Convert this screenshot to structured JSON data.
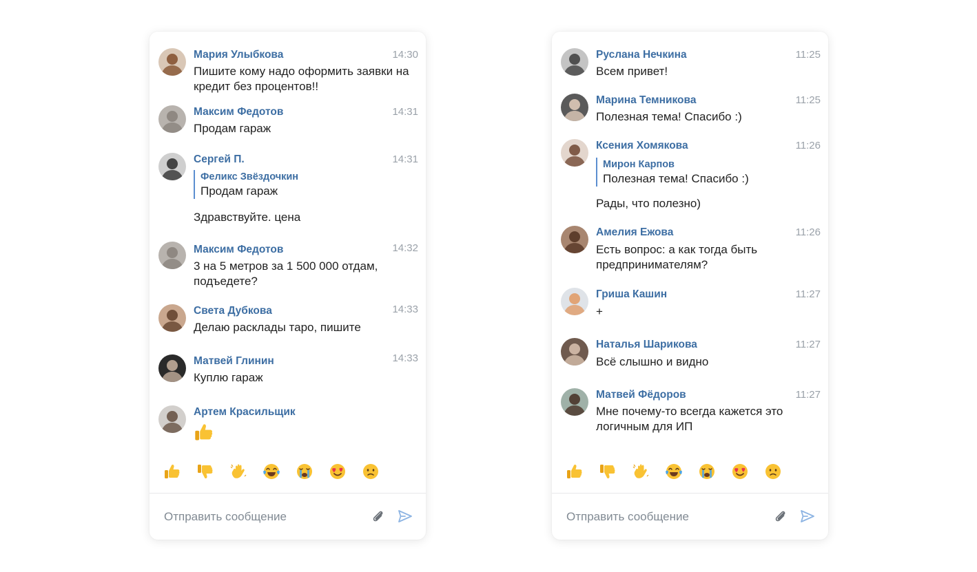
{
  "left_chat": {
    "messages": [
      {
        "author": "Мария Улыбкова",
        "time": "14:30",
        "text": "Пишите кому надо оформить заявки на кредит без процентов!!"
      },
      {
        "author": "Максим Федотов",
        "time": "14:31",
        "text": "Продам гараж"
      },
      {
        "author": "Сергей П.",
        "time": "14:31",
        "quote_author": "Феликс Звёздочкин",
        "quote_text": "Продам гараж",
        "text": "Здравствуйте. цена"
      },
      {
        "author": "Максим Федотов",
        "time": "14:32",
        "text": "3 на 5 метров за 1 500 000 отдам, подъедете?"
      },
      {
        "author": "Света Дубкова",
        "time": "14:33",
        "text": "Делаю расклады таро, пишите"
      },
      {
        "author": "Матвей Глинин",
        "time": "14:33",
        "text": "Куплю гараж"
      },
      {
        "author": "Артем Красильщик",
        "emoji": "thumbs-up-emoji"
      }
    ],
    "reactions": [
      "thumbs-up",
      "thumbs-down",
      "waving-hand",
      "tears-of-joy",
      "crying",
      "heart-eyes",
      "slightly-frowning"
    ],
    "composer": {
      "placeholder": "Отправить сообщение"
    }
  },
  "right_chat": {
    "messages": [
      {
        "author": "Руслана Нечкина",
        "time": "11:25",
        "text": "Всем привет!"
      },
      {
        "author": "Марина Темникова",
        "time": "11:25",
        "text": "Полезная тема! Спасибо :)"
      },
      {
        "author": "Ксения Хомякова",
        "time": "11:26",
        "quote_author": "Мирон Карпов",
        "quote_text": "Полезная тема! Спасибо :)",
        "text": "Рады, что полезно)"
      },
      {
        "author": "Амелия Ежова",
        "time": "11:26",
        "text": "Есть вопрос: а как тогда быть предпринимателям?"
      },
      {
        "author": "Гриша Кашин",
        "time": "11:27",
        "text": "+"
      },
      {
        "author": "Наталья Шарикова",
        "time": "11:27",
        "text": "Всё слышно и видно"
      },
      {
        "author": "Матвей Фёдоров",
        "time": "11:27",
        "text": "Мне почему-то всегда кажется это логичным для ИП"
      }
    ],
    "reactions": [
      "thumbs-up",
      "thumbs-down",
      "waving-hand",
      "tears-of-joy",
      "crying",
      "heart-eyes",
      "slightly-frowning"
    ],
    "composer": {
      "placeholder": "Отправить сообщение"
    }
  },
  "colors": {
    "author": "#3d6ea3",
    "time": "#9aa1a9",
    "text": "#222222",
    "quote_bar": "#5b8ed0",
    "send": "#8db4e3"
  }
}
